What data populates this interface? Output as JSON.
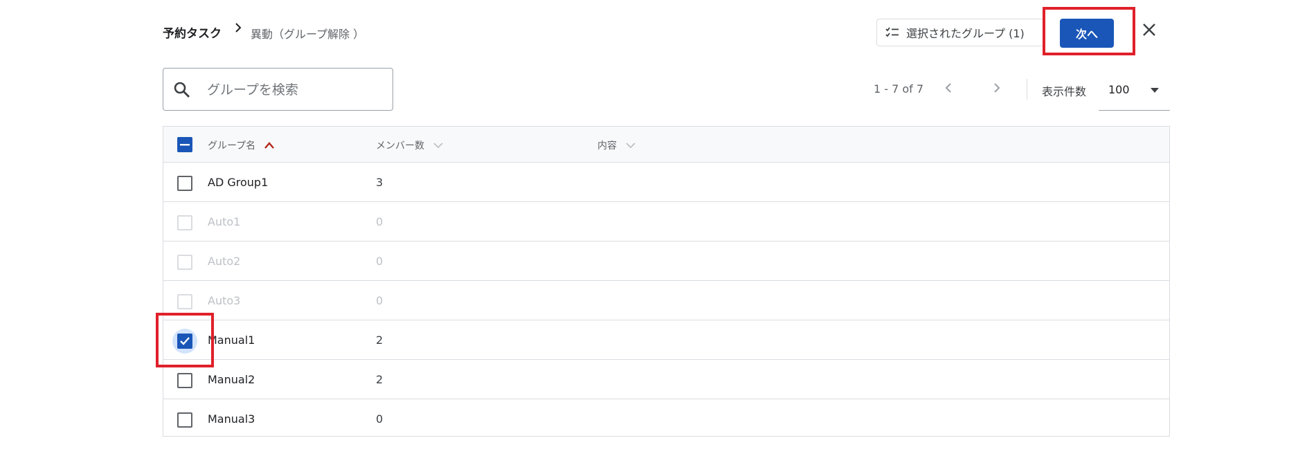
{
  "breadcrumb": {
    "root": "予約タスク",
    "current": "異動（グループ解除 ）"
  },
  "header": {
    "selected_groups_label": "選択されたグループ (1)",
    "next_label": "次へ"
  },
  "search": {
    "placeholder": "グループを検索",
    "value": ""
  },
  "pagination": {
    "range": "1 - 7 of 7",
    "per_page_label": "表示件数",
    "per_page_value": "100"
  },
  "table": {
    "columns": [
      {
        "label": "グループ名",
        "sort": "ascending"
      },
      {
        "label": "メンバー数",
        "sort": "none"
      },
      {
        "label": "内容",
        "sort": "none"
      }
    ],
    "rows": [
      {
        "name": "AD Group1",
        "members": "3",
        "checked": false,
        "disabled": false
      },
      {
        "name": "Auto1",
        "members": "0",
        "checked": false,
        "disabled": true
      },
      {
        "name": "Auto2",
        "members": "0",
        "checked": false,
        "disabled": true
      },
      {
        "name": "Auto3",
        "members": "0",
        "checked": false,
        "disabled": true
      },
      {
        "name": "Manual1",
        "members": "2",
        "checked": true,
        "disabled": false
      },
      {
        "name": "Manual2",
        "members": "2",
        "checked": false,
        "disabled": false
      },
      {
        "name": "Manual3",
        "members": "0",
        "checked": false,
        "disabled": false
      }
    ]
  },
  "colors": {
    "primary": "#1a56b8",
    "highlight": "#e0202a",
    "sort_active": "#b3261e"
  }
}
